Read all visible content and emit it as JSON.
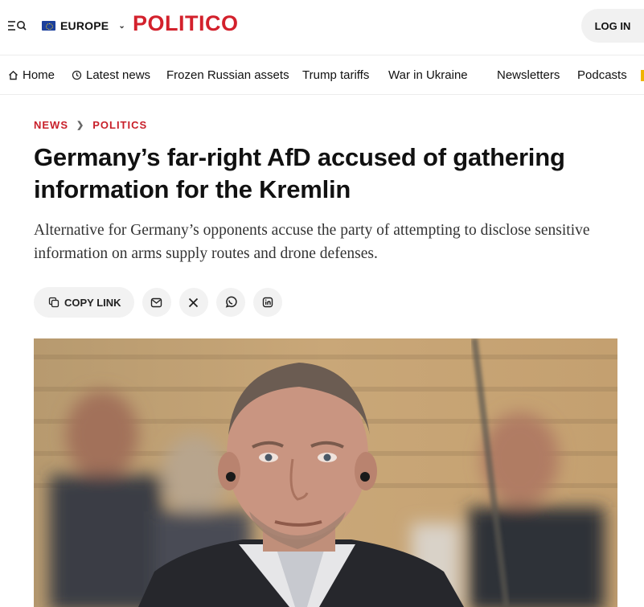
{
  "header": {
    "menu_icon": "menu-search-icon",
    "edition_label": "EUROPE",
    "logo_text": "POLITICO",
    "login_label": "LOG IN",
    "brand_color": "#d3212c"
  },
  "nav": {
    "items": [
      {
        "label": "Home",
        "icon": "home-icon"
      },
      {
        "label": "Latest news",
        "icon": "clock-icon"
      },
      {
        "label": "Frozen Russian assets"
      },
      {
        "label": "Trump tariffs"
      },
      {
        "label": "War in Ukraine"
      },
      {
        "label": "Newsletters"
      },
      {
        "label": "Podcasts"
      }
    ]
  },
  "article": {
    "breadcrumb": [
      "NEWS",
      "POLITICS"
    ],
    "headline": "Germany’s far-right AfD accused of gathering information for the Kremlin",
    "dek": "Alternative for Germany’s opponents accuse the party of attempting to disclose sensitive information on arms supply routes and drone defenses.",
    "share": {
      "copy_link_label": "COPY LINK",
      "buttons": [
        "email-icon",
        "x-icon",
        "whatsapp-icon",
        "linkedin-icon"
      ]
    },
    "hero_image": "photo of a man in a suit wearing an earpiece at a meeting"
  }
}
